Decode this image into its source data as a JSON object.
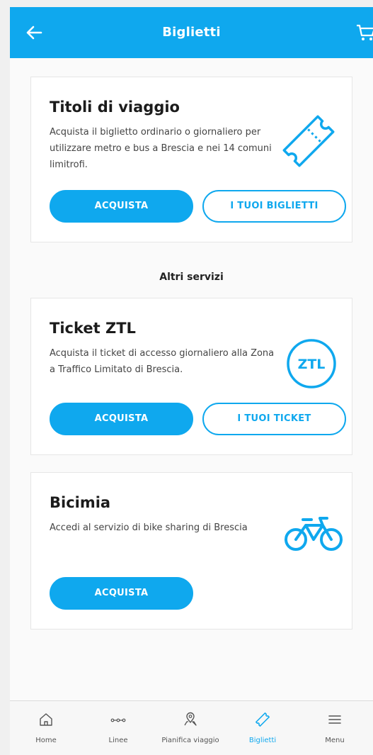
{
  "header": {
    "title": "Biglietti",
    "back_icon": "arrow-left-icon",
    "cart_icon": "cart-icon"
  },
  "cards": [
    {
      "title": "Titoli di viaggio",
      "description": "Acquista il biglietto ordinario o giornaliero per utilizzare metro e bus a Brescia e nei 14 comuni limitrofi.",
      "icon": "ticket-icon",
      "primary_label": "ACQUISTA",
      "secondary_label": "I TUOI BIGLIETTI"
    },
    {
      "title": "Ticket ZTL",
      "description": "Acquista il ticket di accesso giornaliero alla Zona a Traffico Limitato di Brescia.",
      "icon": "ztl-icon",
      "icon_text": "ZTL",
      "primary_label": "ACQUISTA",
      "secondary_label": "I TUOI TICKET"
    },
    {
      "title": "Bicimia",
      "description": "Accedi al servizio di bike sharing di Brescia",
      "icon": "bicycle-icon",
      "primary_label": "ACQUISTA"
    }
  ],
  "section_label": "Altri servizi",
  "bottom_nav": {
    "items": [
      {
        "label": "Home",
        "icon": "home-icon"
      },
      {
        "label": "Linee",
        "icon": "route-dots-icon"
      },
      {
        "label": "Pianifica viaggio",
        "icon": "map-pin-icon"
      },
      {
        "label": "Biglietti",
        "icon": "ticket-icon",
        "active": true
      },
      {
        "label": "Menu",
        "icon": "hamburger-menu-icon"
      }
    ]
  },
  "colors": {
    "accent": "#0fa8ee",
    "background": "#fafafa",
    "text": "#1d1d1d"
  }
}
